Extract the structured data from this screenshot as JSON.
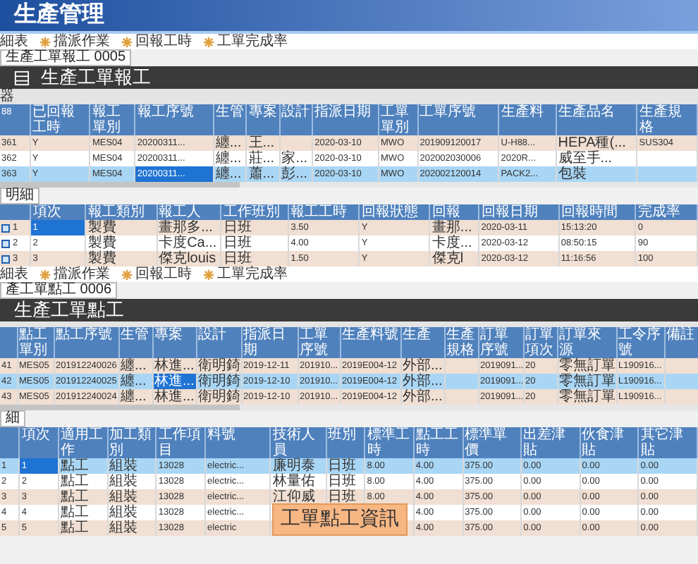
{
  "app_header": {
    "title": "生產管理"
  },
  "windows": [
    {
      "menu": [
        "細表",
        "擋派作業",
        "回報工時",
        "工單完成率"
      ],
      "tab": {
        "label": "生產工單報工 0005",
        "selected": true
      },
      "title": "生產工單報工",
      "title_icon": true,
      "filter_label": "器",
      "master": {
        "columns": [
          "88",
          "已回報工時",
          "報工單別",
          "報工序號",
          "生管",
          "專案",
          "設計",
          "指派日期",
          "工單單別",
          "工單序號",
          "生產料",
          "生產品名",
          "生產規格"
        ],
        "rows": [
          {
            "cells": [
              "361",
              "Y",
              "MES04",
              "20200311...",
              "纏...",
              "王...",
              null,
              "2020-03-10",
              "MWO",
              "201909120017",
              "U-H88...",
              "HEPA種(...",
              "SUS304"
            ],
            "selected": false
          },
          {
            "cells": [
              "362",
              "Y",
              "MES04",
              "20200311...",
              "纏...",
              "莊...",
              "家...",
              "2020-03-10",
              "MWO",
              "202002030006",
              "2020R...",
              "威至手...",
              null
            ],
            "selected": false
          },
          {
            "cells": [
              "363",
              "Y",
              "MES04",
              {
                "text": "20200311...",
                "focused": true
              },
              "纏...",
              "蕭...",
              "彭...",
              "2020-03-10",
              "MWO",
              "202002120014",
              "PACK2...",
              "包裝",
              null
            ],
            "selected": true
          }
        ]
      },
      "detail_tab": {
        "label": "明細",
        "selected": true
      },
      "detail": {
        "row_icon": true,
        "columns": [
          null,
          "項次",
          "報工類別",
          "報工人",
          "工作班別",
          "報工工時",
          "回報狀態",
          "回報",
          "回報日期",
          "回報時間",
          "完成率"
        ],
        "rows": [
          {
            "cells": [
              "1",
              {
                "text": "1",
                "focused": true
              },
              "製費",
              "畫那多...",
              "日班",
              "3.50",
              "Y",
              "畫那...",
              "2020-03-11",
              "15:13:20",
              "0"
            ],
            "selected": false
          },
          {
            "cells": [
              "2",
              "2",
              "製費",
              "卡度Ca...",
              "日班",
              "4.00",
              "Y",
              "卡度...",
              "2020-03-12",
              "08:50:15",
              "90"
            ],
            "selected": false
          },
          {
            "cells": [
              "3",
              "3",
              "製費",
              "傑克louis",
              "日班",
              "1.50",
              "Y",
              "傑克l",
              "2020-03-12",
              "11:16:56",
              "100"
            ],
            "selected": false
          }
        ]
      }
    },
    {
      "menu": [
        "細表",
        "擋派作業",
        "回報工時",
        "工單完成率"
      ],
      "tab": {
        "label": "產工單點工 0006",
        "selected": true
      },
      "title": "生產工單點工",
      "master": {
        "columns": [
          null,
          "點工單別",
          "點工序號",
          "生管",
          "專案",
          "設計",
          "指派日期",
          "工單序號",
          "生產料號",
          "生產",
          "生產規格",
          "訂單序號",
          "訂單項次",
          "訂單來源",
          "工令序號",
          "備註"
        ],
        "rows": [
          {
            "cells": [
              "41",
              "MES05",
              "201912240026",
              "纏...",
              "林進...",
              "衛明錡",
              "2019-12-11",
              "201910...",
              "2019E004-12",
              "外部...",
              null,
              "2019091...",
              "20",
              "零無訂單",
              "L190916...",
              null
            ],
            "selected": false
          },
          {
            "cells": [
              "42",
              "MES05",
              "201912240025",
              "纏...",
              {
                "text": "林進...",
                "focused": true
              },
              "衛明錡",
              "2019-12-10",
              "201910...",
              "2019E004-12",
              "外部...",
              null,
              "2019091...",
              "20",
              "零無訂單",
              "L190916...",
              null
            ],
            "selected": true
          },
          {
            "cells": [
              "43",
              "MES05",
              "201912240024",
              "纏...",
              "林進...",
              "衛明錡",
              "2019-12-10",
              "201910...",
              "2019E004-12",
              "外部...",
              null,
              "2019091...",
              "20",
              "零無訂單",
              "L190916...",
              null
            ],
            "selected": false
          }
        ]
      },
      "detail_tab": {
        "label": "細",
        "selected": true
      },
      "detail": {
        "columns": [
          null,
          "項次",
          "適用工作",
          "加工類別",
          "工作項目",
          "料號",
          "技術人員",
          "班別",
          "標準工時",
          "點工工時",
          "標準單價",
          "出差津貼",
          "伙食津貼",
          "其它津貼"
        ],
        "rows": [
          {
            "cells": [
              "1",
              {
                "text": "1",
                "focused": true
              },
              "點工",
              "組裝",
              "13028",
              "electric...",
              "廉明泰",
              "日班",
              "8.00",
              "4.00",
              "375.00",
              "0.00",
              "0.00",
              "0.00"
            ],
            "selected": true
          },
          {
            "cells": [
              "2",
              "2",
              "點工",
              "組裝",
              "13028",
              "electric...",
              "林量佑",
              "日班",
              "8.00",
              "4.00",
              "375.00",
              "0.00",
              "0.00",
              "0.00"
            ],
            "selected": false
          },
          {
            "cells": [
              "3",
              "3",
              "點工",
              "組裝",
              "13028",
              "electric...",
              "江仰威",
              "日班",
              "8.00",
              "4.00",
              "375.00",
              "0.00",
              "0.00",
              "0.00"
            ],
            "selected": false
          },
          {
            "cells": [
              "4",
              "4",
              "點工",
              "組裝",
              "13028",
              "electric...",
              null,
              null,
              null,
              "4.00",
              "375.00",
              "0.00",
              "0.00",
              "0.00"
            ],
            "selected": false
          },
          {
            "cells": [
              "5",
              "5",
              "點工",
              "組裝",
              "13028",
              "electric",
              null,
              null,
              null,
              "4.00",
              "375.00",
              "0.00",
              "0.00",
              "0.00"
            ],
            "selected": false
          }
        ]
      }
    }
  ],
  "overlay_caption": "工單點工資訊"
}
